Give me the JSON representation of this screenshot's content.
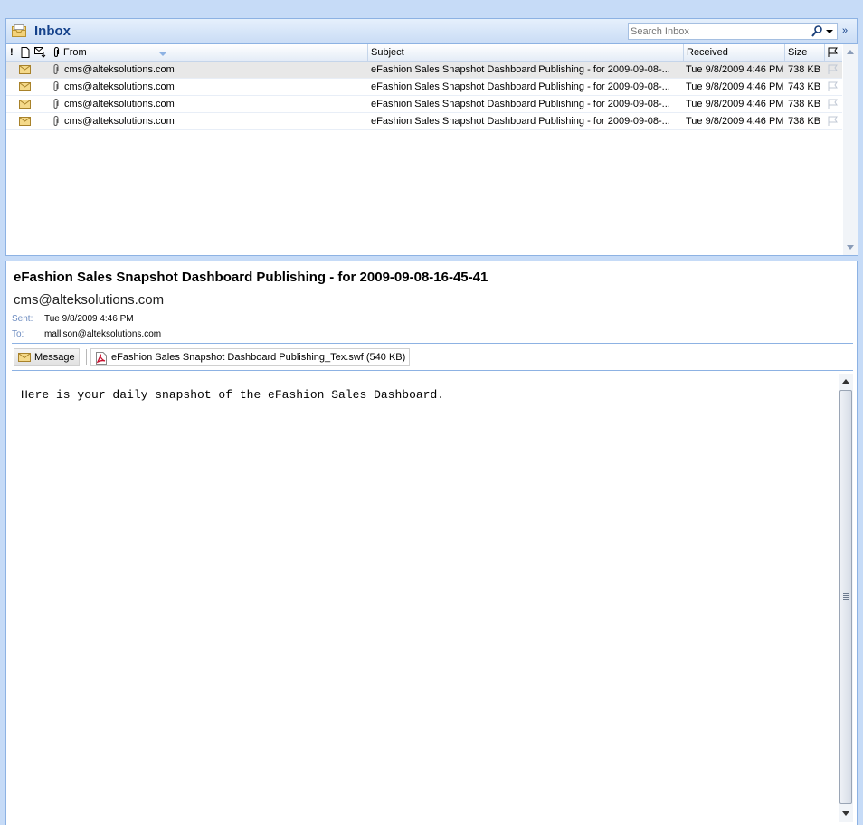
{
  "header": {
    "title": "Inbox",
    "search_placeholder": "Search Inbox"
  },
  "list": {
    "columns": {
      "importance": "!",
      "from": "From",
      "subject": "Subject",
      "received": "Received",
      "size": "Size"
    },
    "rows": [
      {
        "from": "cms@alteksolutions.com",
        "subject": "eFashion Sales Snapshot Dashboard Publishing - for 2009-09-08-...",
        "received": "Tue 9/8/2009 4:46 PM",
        "size": "738 KB",
        "selected": true
      },
      {
        "from": "cms@alteksolutions.com",
        "subject": "eFashion Sales Snapshot Dashboard Publishing - for 2009-09-08-...",
        "received": "Tue 9/8/2009 4:46 PM",
        "size": "743 KB",
        "selected": false
      },
      {
        "from": "cms@alteksolutions.com",
        "subject": "eFashion Sales Snapshot Dashboard Publishing - for 2009-09-08-...",
        "received": "Tue 9/8/2009 4:46 PM",
        "size": "738 KB",
        "selected": false
      },
      {
        "from": "cms@alteksolutions.com",
        "subject": "eFashion Sales Snapshot Dashboard Publishing - for 2009-09-08-...",
        "received": "Tue 9/8/2009 4:46 PM",
        "size": "738 KB",
        "selected": false
      }
    ]
  },
  "reading_pane": {
    "subject": "eFashion Sales Snapshot Dashboard Publishing - for 2009-09-08-16-45-41",
    "from": "cms@alteksolutions.com",
    "sent_label": "Sent:",
    "sent_value": "Tue 9/8/2009 4:46 PM",
    "to_label": "To:",
    "to_value": "mallison@alteksolutions.com",
    "message_tab": "Message",
    "attachment": "eFashion Sales Snapshot Dashboard Publishing_Tex.swf (540 KB)",
    "body": "Here is your daily snapshot of the eFashion Sales Dashboard."
  },
  "colors": {
    "accent": "#15428b",
    "border": "#8db2e3",
    "background": "#c6dbf7"
  }
}
